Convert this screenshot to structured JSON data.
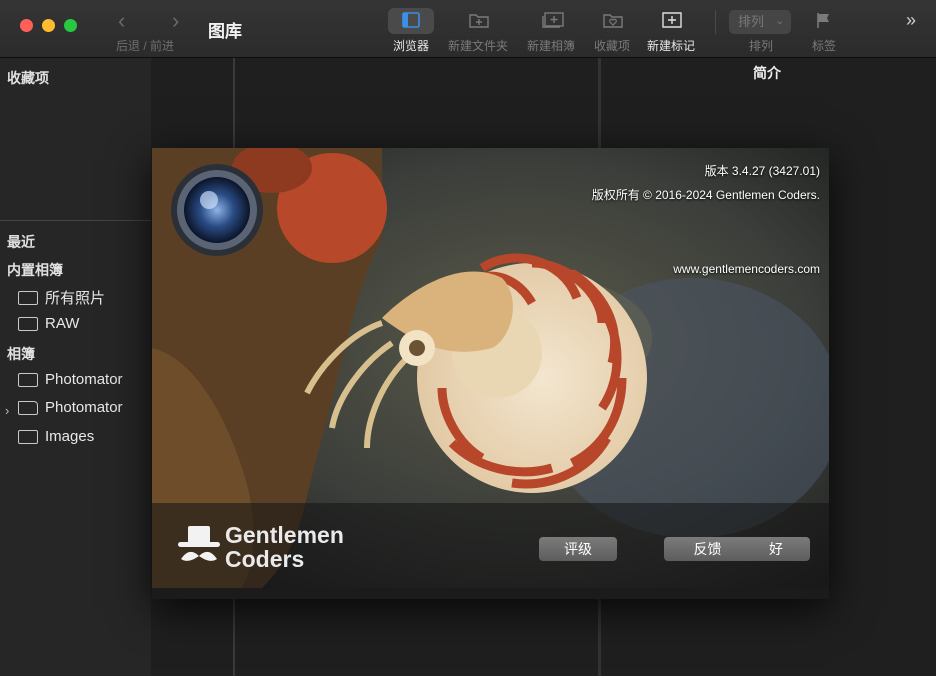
{
  "window": {
    "title": "图库"
  },
  "nav": {
    "back_forward_label": "后退 / 前进"
  },
  "toolbar": {
    "browser": "浏览器",
    "new_folder": "新建文件夹",
    "new_album": "新建相簿",
    "favorites": "收藏项",
    "new_mark": "新建标记",
    "sort": "排列",
    "sort_value": "排列",
    "tags": "标签"
  },
  "sidebar": {
    "favorites_header": "收藏项",
    "recent": "最近",
    "builtin_header": "内置相簿",
    "all_photos": "所有照片",
    "raw": "RAW",
    "albums_header": "相簿",
    "items": [
      "Photomator",
      "Photomator",
      "Images"
    ]
  },
  "right_pane": {
    "title": "简介"
  },
  "about": {
    "version": "版本 3.4.27 (3427.01)",
    "copyright": "版权所有 © 2016-2024 Gentlemen Coders.",
    "website": "www.gentlemencoders.com",
    "brand_line1": "Gentlemen",
    "brand_line2": "Coders",
    "buttons": {
      "rate": "评级",
      "feedback": "反馈",
      "ok": "好"
    }
  }
}
